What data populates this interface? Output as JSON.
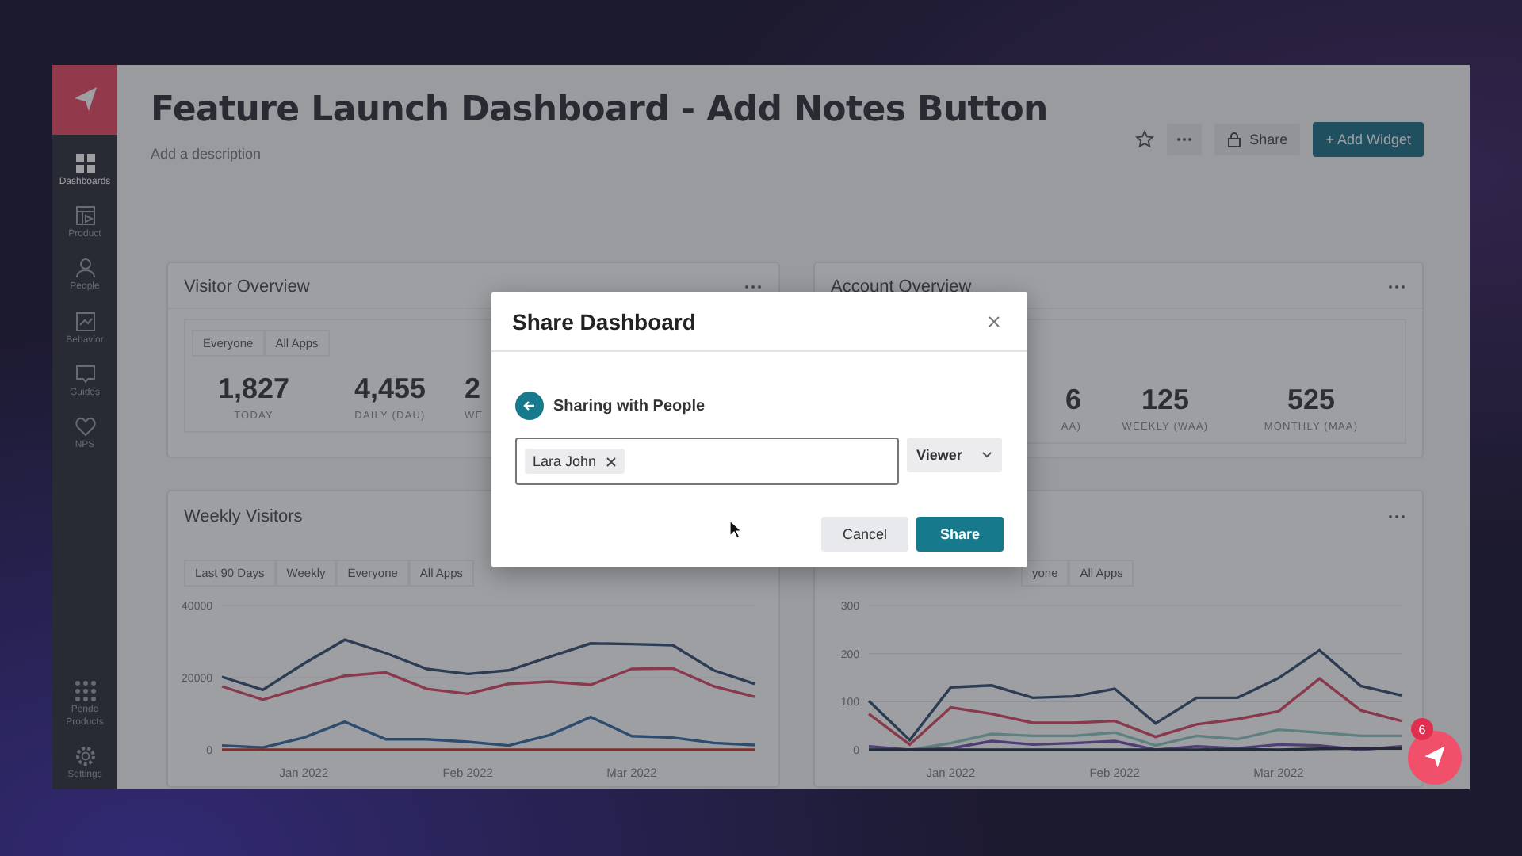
{
  "sidebar": {
    "items": [
      {
        "label": "Dashboards",
        "selected": true
      },
      {
        "label": "Product",
        "selected": false
      },
      {
        "label": "People",
        "selected": false
      },
      {
        "label": "Behavior",
        "selected": false
      },
      {
        "label": "Guides",
        "selected": false
      },
      {
        "label": "NPS",
        "selected": false
      }
    ],
    "bottom_items": [
      {
        "label": "Pendo Products"
      },
      {
        "label": "Settings"
      }
    ]
  },
  "header": {
    "title": "Feature Launch Dashboard - Add Notes Button",
    "placeholder": "Add a description",
    "share": "Share",
    "add_widget": "+ Add Widget"
  },
  "overview_cards": [
    {
      "title": "Visitor Overview",
      "filters": [
        "Everyone",
        "All Apps"
      ],
      "stats": [
        {
          "value": "1,827",
          "label": "TODAY"
        },
        {
          "value": "4,455",
          "label": "DAILY (DAU)"
        },
        {
          "value": "2",
          "label": "WE"
        }
      ]
    },
    {
      "title": "Account Overview",
      "stats": [
        {
          "value": "6",
          "label": "AA)"
        },
        {
          "value": "125",
          "label": "WEEKLY (WAA)"
        },
        {
          "value": "525",
          "label": "MONTHLY (MAA)"
        }
      ]
    }
  ],
  "chart_cards": [
    {
      "title": "Weekly Visitors",
      "filters": [
        "Last 90 Days",
        "Weekly",
        "Everyone",
        "All Apps"
      ],
      "chart_data": {
        "type": "line",
        "categories": [
          null,
          null,
          "Jan 2022",
          null,
          null,
          null,
          "Feb 2022",
          null,
          null,
          null,
          "Mar 2022",
          null,
          null,
          null
        ],
        "ylim": [
          0,
          40000
        ],
        "yticks": [
          0,
          20000,
          40000
        ],
        "series": [
          {
            "color": "#2c3d53",
            "values": [
              20200,
              16600,
              23900,
              30500,
              26800,
              22400,
              21000,
              22000,
              25800,
              29500,
              29300,
              29000,
              22000,
              18300
            ]
          },
          {
            "color": "#89394b",
            "values": [
              17600,
              13900,
              17300,
              20500,
              21400,
              16900,
              15500,
              18300,
              18900,
              18000,
              22400,
              22600,
              17600,
              14700
            ]
          },
          {
            "color": "#2c4d6f",
            "values": [
              1200,
              600,
              3400,
              7800,
              2900,
              2900,
              2200,
              1200,
              4100,
              9100,
              3800,
              3400,
              1900,
              1300
            ]
          },
          {
            "color": "#7c322e",
            "values": [
              0,
              0,
              0,
              0,
              0,
              0,
              0,
              0,
              0,
              0,
              0,
              0,
              0,
              0
            ]
          }
        ]
      }
    },
    {
      "filters": [
        "yone",
        "All Apps"
      ],
      "chart_data": {
        "type": "line",
        "categories": [
          null,
          null,
          "Jan 2022",
          null,
          null,
          null,
          "Feb 2022",
          null,
          null,
          null,
          "Mar 2022",
          null,
          null,
          null
        ],
        "ylim": [
          0,
          300
        ],
        "yticks": [
          0,
          100,
          200,
          300
        ],
        "series": [
          {
            "color": "#2c3d53",
            "values": [
              102,
              20,
              130,
              134,
              108,
              111,
              127,
              55,
              108,
              108,
              149,
              207,
              133,
              113
            ]
          },
          {
            "color": "#89394b",
            "values": [
              75,
              11,
              88,
              75,
              56,
              56,
              60,
              27,
              53,
              64,
              80,
              148,
              82,
              60
            ]
          },
          {
            "color": "#5f8081",
            "values": [
              3,
              0,
              14,
              33,
              29,
              29,
              36,
              9,
              29,
              22,
              42,
              36,
              29,
              29
            ]
          },
          {
            "color": "#4e3f77",
            "values": [
              7,
              0,
              3,
              18,
              11,
              14,
              18,
              0,
              7,
              3,
              11,
              9,
              0,
              7
            ]
          },
          {
            "color": "#222b37",
            "values": [
              0,
              0,
              0,
              0,
              0,
              0,
              0,
              0,
              0,
              1,
              0,
              2,
              3,
              3
            ]
          }
        ]
      }
    }
  ],
  "modal": {
    "title": "Share Dashboard",
    "section": "Sharing with People",
    "recipients": [
      "Lara John"
    ],
    "role": "Viewer",
    "cancel": "Cancel",
    "share": "Share"
  },
  "help": {
    "badge": "6"
  }
}
